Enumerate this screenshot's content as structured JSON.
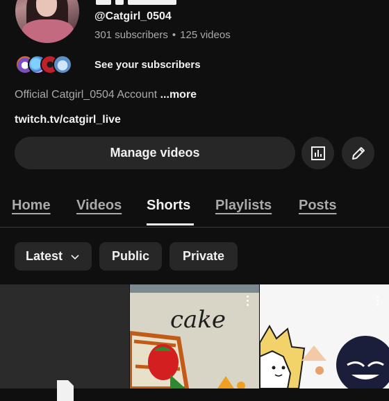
{
  "channel": {
    "handle": "@Catgirl_0504",
    "subscribers": "301 subscribers",
    "separator": "•",
    "videos": "125 videos",
    "see_subscribers": "See your subscribers",
    "description": "Official Catgirl_0504  Account",
    "more": "...more",
    "link": "twitch.tv/catgirl_live"
  },
  "actions": {
    "manage_videos": "Manage videos",
    "analytics_icon": "analytics-icon",
    "edit_icon": "pencil-icon"
  },
  "tabs": [
    {
      "label": "Home"
    },
    {
      "label": "Videos"
    },
    {
      "label": "Shorts",
      "selected": true
    },
    {
      "label": "Playlists"
    },
    {
      "label": "Posts"
    }
  ],
  "filters": {
    "latest": "Latest",
    "public": "Public",
    "private": "Private"
  },
  "shorts": [
    {
      "thumb": "dark-thumbnail"
    },
    {
      "thumb": "cake-drawing",
      "text": "cake"
    },
    {
      "thumb": "cat-drawing"
    }
  ],
  "colors": {
    "background": "#0f0f0f",
    "surface": "#272727",
    "text_primary": "#f1f1f1",
    "text_secondary": "#aaaaaa"
  }
}
